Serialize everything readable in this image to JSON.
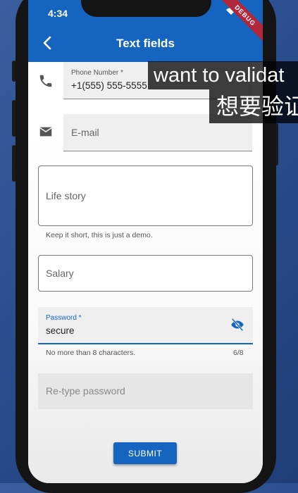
{
  "status_bar": {
    "time": "4:34",
    "debug_banner": "DEBUG"
  },
  "app_bar": {
    "title": "Text fields",
    "back_icon": "arrow-back-icon"
  },
  "fields": {
    "phone": {
      "label": "Phone Number *",
      "value": "+1(555) 555-5555",
      "icon": "phone-icon"
    },
    "email": {
      "placeholder": "E-mail",
      "icon": "email-icon"
    },
    "life_story": {
      "placeholder": "Life story",
      "helper": "Keep it short, this is just a demo."
    },
    "salary": {
      "placeholder": "Salary"
    },
    "password": {
      "label": "Password *",
      "value": "secure",
      "helper": "No more than 8 characters.",
      "counter": "6/8",
      "icon": "visibility-off-icon"
    },
    "retype_password": {
      "placeholder": "Re-type password"
    }
  },
  "submit_label": "SUBMIT",
  "captions": {
    "line1": "want to validat",
    "line2": "想要验证"
  },
  "colors": {
    "primary": "#1565c0",
    "debug": "#b0283a"
  }
}
